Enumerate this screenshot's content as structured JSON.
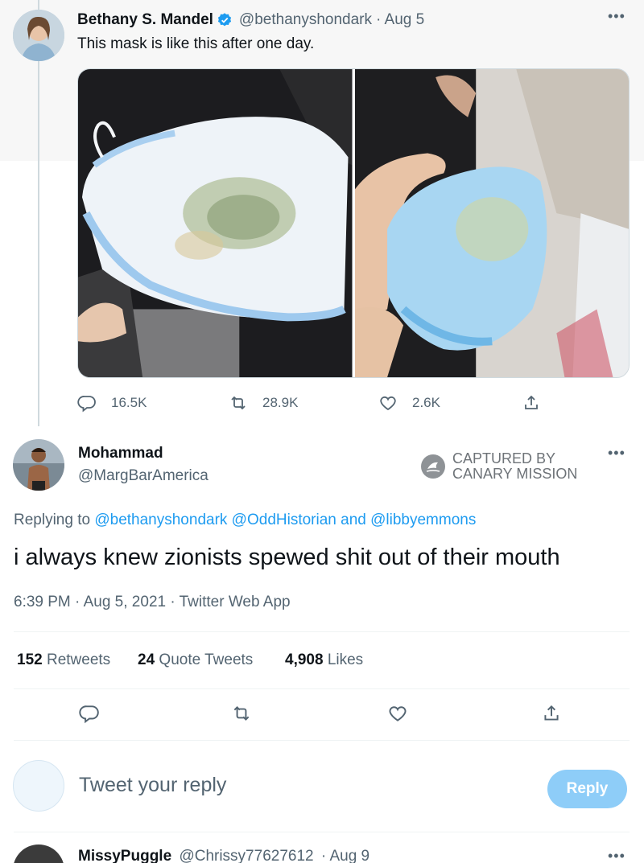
{
  "parent_tweet": {
    "author_name": "Bethany S. Mandel",
    "handle": "@bethanyshondark",
    "time": "· Aug 5",
    "text": "This mask is like this after one day.",
    "replies": "16.5K",
    "retweets": "28.9K",
    "likes": "2.6K"
  },
  "main_tweet": {
    "author_name": "Mohammad",
    "handle": "@MargBarAmerica",
    "replying_prefix": "Replying to",
    "replying_to": "@bethanyshondark @OddHistorian",
    "replying_and": "and",
    "replying_last": "@libbyemmons",
    "text": "i always knew zionists spewed shit out of their mouth",
    "meta": "6:39 PM · Aug 5, 2021 · Twitter Web App",
    "retweets_count": "152",
    "retweets_label": "Retweets",
    "quote_count": "24",
    "quote_label": "Quote Tweets",
    "likes_count": "4,908",
    "likes_label": "Likes"
  },
  "watermark": {
    "line1": "CAPTURED BY",
    "line2": "CANARY MISSION"
  },
  "reply_box": {
    "placeholder": "Tweet your reply",
    "button_label": "Reply"
  },
  "next_reply": {
    "author_name": "MissyPuggle",
    "handle": "@Chrissy77627612",
    "time": "· Aug 9"
  },
  "colors": {
    "accent": "#1d9bf0",
    "verified": "#1d9bf0",
    "reply_button_disabled": "#8ecdf8"
  },
  "icons": [
    "verified-badge-icon",
    "more-icon",
    "reply-icon",
    "retweet-icon",
    "like-icon",
    "share-icon",
    "canary-mission-logo-icon"
  ]
}
